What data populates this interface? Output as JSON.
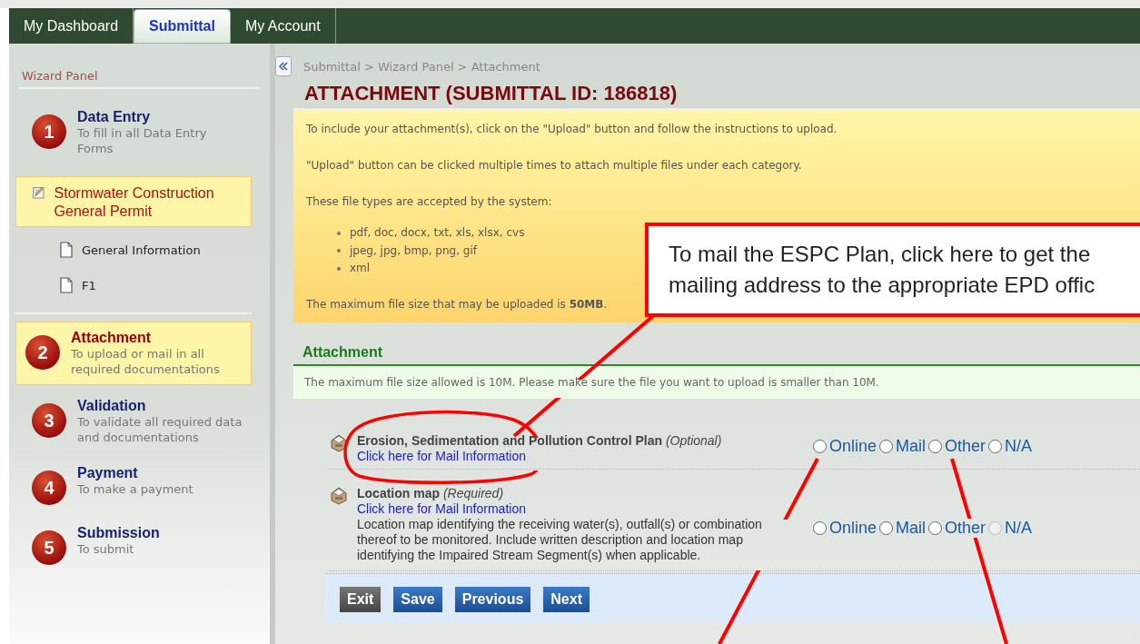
{
  "tabs": [
    {
      "label": "My Dashboard",
      "selected": false
    },
    {
      "label": "Submittal",
      "selected": true
    },
    {
      "label": "My Account",
      "selected": false
    }
  ],
  "sidebar": {
    "title": "Wizard Panel",
    "steps": [
      {
        "number": "1",
        "title": "Data Entry",
        "description": "To fill in all Data Entry Forms",
        "selected": false,
        "children": [
          {
            "label": "Stormwater Construction General Permit",
            "selected": true,
            "children": [
              {
                "label": "General Information",
                "selected": false
              },
              {
                "label": "F1",
                "selected": false
              }
            ]
          }
        ]
      },
      {
        "number": "2",
        "title": "Attachment",
        "description": "To upload or mail in all required documentations",
        "selected": true
      },
      {
        "number": "3",
        "title": "Validation",
        "description": "To validate all required data and documentations",
        "selected": false
      },
      {
        "number": "4",
        "title": "Payment",
        "description": "To make a payment",
        "selected": false
      },
      {
        "number": "5",
        "title": "Submission",
        "description": "To submit",
        "selected": false
      }
    ]
  },
  "breadcrumb": "Submittal > Wizard Panel > Attachment",
  "page_title": "ATTACHMENT (SUBMITTAL ID: 186818)",
  "info": {
    "paragraphs": [
      "To include your attachment(s), click on the \"Upload\" button and follow the instructions to upload.",
      "\"Upload\" button can be clicked multiple times to attach multiple files under each category.",
      "These file types are accepted by the system:"
    ],
    "file_types": [
      "pdf, doc, docx, txt, xls, xlsx, cvs",
      "jpeg, jpg, bmp, png, gif",
      "xml"
    ],
    "max_size": "The maximum file size that may be uploaded is **50MB**."
  },
  "section": {
    "title": "Attachment",
    "note": "The maximum file size allowed is 10M. Please make sure the file you want to upload is smaller than 10M."
  },
  "attachments": [
    {
      "title": "Erosion, Sedimentation and Pollution Control Plan",
      "requirement": "(Optional)",
      "link": "Click here for Mail Information",
      "options": [
        {
          "label": "Online",
          "selected": false,
          "disabled": false
        },
        {
          "label": "Mail",
          "selected": false,
          "disabled": false
        },
        {
          "label": "Other",
          "selected": false,
          "disabled": false
        },
        {
          "label": "N/A",
          "selected": false,
          "disabled": false
        }
      ]
    },
    {
      "title": "Location map",
      "requirement": "(Required)",
      "link": "Click here for Mail Information",
      "description": "Location map identifying the receiving water(s), outfall(s) or combination thereof to be monitored. Include written description and location map identifying the Impaired Stream Segment(s) when applicable.",
      "options": [
        {
          "label": "Online",
          "selected": false,
          "disabled": false
        },
        {
          "label": "Mail",
          "selected": false,
          "disabled": false
        },
        {
          "label": "Other",
          "selected": false,
          "disabled": false
        },
        {
          "label": "N/A",
          "selected": false,
          "disabled": true
        }
      ]
    }
  ],
  "buttons": [
    {
      "label": "Exit",
      "kind": "secondary"
    },
    {
      "label": "Save",
      "kind": "primary"
    },
    {
      "label": "Previous",
      "kind": "primary"
    },
    {
      "label": "Next",
      "kind": "primary"
    }
  ],
  "annotation": {
    "lines": [
      "To mail the ESPC Plan, click here to get the",
      "mailing address to the appropriate EPD offic"
    ]
  }
}
